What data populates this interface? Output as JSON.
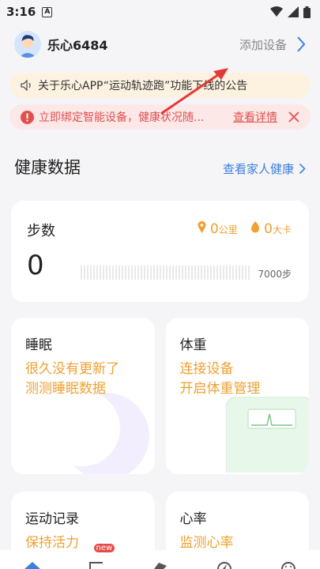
{
  "status_bar": {
    "time": "3:16",
    "notification_icon": "A"
  },
  "header": {
    "username": "乐心6484",
    "add_device": "添加设备"
  },
  "notice_banner": {
    "text": "关于乐心APP“运动轨迹跑”功能下线的公告"
  },
  "alert_banner": {
    "text": "立即绑定智能设备，健康状况随...",
    "detail_link": "查看详情"
  },
  "health": {
    "title": "健康数据",
    "family_link": "查看家人健康"
  },
  "steps": {
    "title": "步数",
    "value": "0",
    "distance": "0",
    "distance_unit": "公里",
    "calories": "0",
    "calories_unit": "大卡",
    "goal": "7000步"
  },
  "sleep": {
    "title": "睡眠",
    "line1": "很久没有更新了",
    "line2": "测测睡眠数据"
  },
  "weight": {
    "title": "体重",
    "line1": "连接设备",
    "line2": "开启体重管理"
  },
  "exercise": {
    "title": "运动记录",
    "line1": "保持活力"
  },
  "heart": {
    "title": "心率",
    "line1": "监测心率"
  },
  "tabbar": {
    "badge": "new"
  },
  "colors": {
    "accent": "#f0a030",
    "link": "#3b7fe0",
    "alert": "#e05050"
  }
}
